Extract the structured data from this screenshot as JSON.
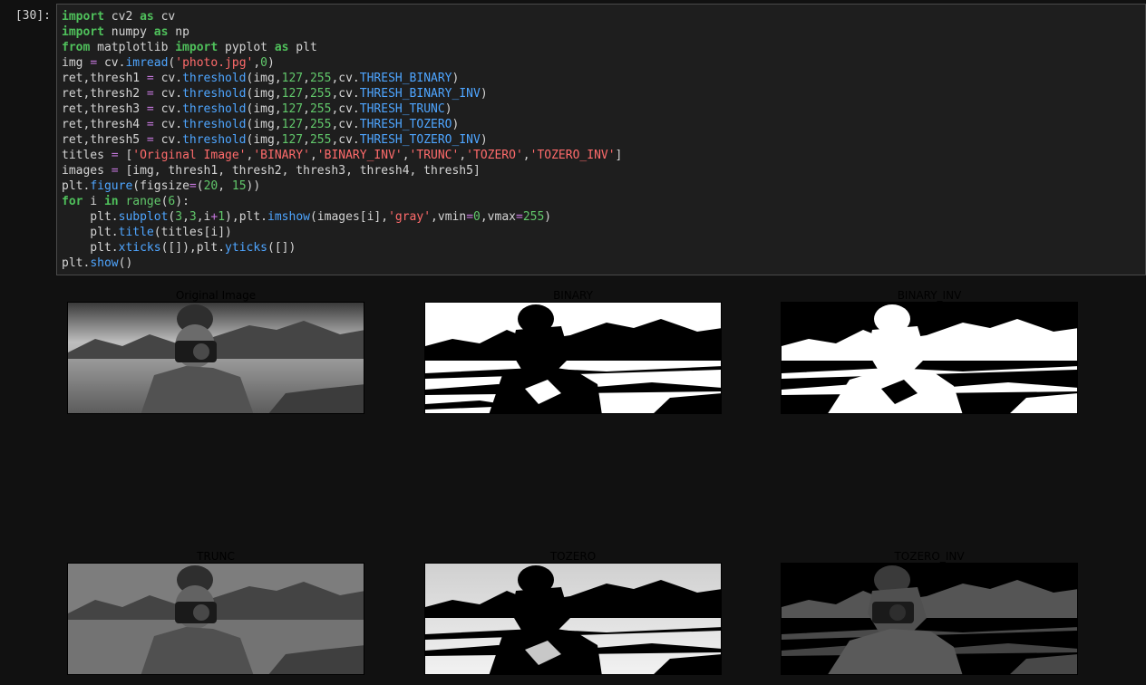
{
  "cell": {
    "prompt": "[30]:",
    "code": {
      "l1": [
        "import",
        " cv2 ",
        "as",
        " cv"
      ],
      "l2": [
        "import",
        " numpy ",
        "as",
        " np"
      ],
      "l3": [
        "from",
        " matplotlib ",
        "import",
        " pyplot ",
        "as",
        " plt"
      ],
      "l4": [
        "img ",
        "=",
        " cv.",
        "imread",
        "(",
        "'photo.jpg'",
        ",",
        "0",
        ")"
      ],
      "l5": [
        "ret,thresh1 ",
        "=",
        " cv.",
        "threshold",
        "(img,",
        "127",
        ",",
        "255",
        ",cv.",
        "THRESH_BINARY",
        ")"
      ],
      "l6": [
        "ret,thresh2 ",
        "=",
        " cv.",
        "threshold",
        "(img,",
        "127",
        ",",
        "255",
        ",cv.",
        "THRESH_BINARY_INV",
        ")"
      ],
      "l7": [
        "ret,thresh3 ",
        "=",
        " cv.",
        "threshold",
        "(img,",
        "127",
        ",",
        "255",
        ",cv.",
        "THRESH_TRUNC",
        ")"
      ],
      "l8": [
        "ret,thresh4 ",
        "=",
        " cv.",
        "threshold",
        "(img,",
        "127",
        ",",
        "255",
        ",cv.",
        "THRESH_TOZERO",
        ")"
      ],
      "l9": [
        "ret,thresh5 ",
        "=",
        " cv.",
        "threshold",
        "(img,",
        "127",
        ",",
        "255",
        ",cv.",
        "THRESH_TOZERO_INV",
        ")"
      ],
      "l10": [
        "titles ",
        "=",
        " [",
        "'Original Image'",
        ",",
        "'BINARY'",
        ",",
        "'BINARY_INV'",
        ",",
        "'TRUNC'",
        ",",
        "'TOZERO'",
        ",",
        "'TOZERO_INV'",
        "]"
      ],
      "l11": [
        "images ",
        "=",
        " [img, thresh1, thresh2, thresh3, thresh4, thresh5]"
      ],
      "l12": [
        "plt.",
        "figure",
        "(figsize",
        "=",
        "(",
        "20",
        ", ",
        "15",
        "))"
      ],
      "l13": [
        "for",
        " i ",
        "in",
        " ",
        "range",
        "(",
        "6",
        "):"
      ],
      "l14": [
        "    plt.",
        "subplot",
        "(",
        "3",
        ",",
        "3",
        ",i",
        "+",
        "1",
        "),plt.",
        "imshow",
        "(images[i],",
        "'gray'",
        ",vmin",
        "=",
        "0",
        ",vmax",
        "=",
        "255",
        ")"
      ],
      "l15": [
        "    plt.",
        "title",
        "(titles[i])"
      ],
      "l16": [
        "    plt.",
        "xticks",
        "([]),plt.",
        "yticks",
        "([])"
      ],
      "l17": [
        "plt.",
        "show",
        "()"
      ]
    }
  },
  "output": {
    "titles": [
      "Original Image",
      "BINARY",
      "BINARY_INV",
      "TRUNC",
      "TOZERO",
      "TOZERO_INV"
    ]
  }
}
